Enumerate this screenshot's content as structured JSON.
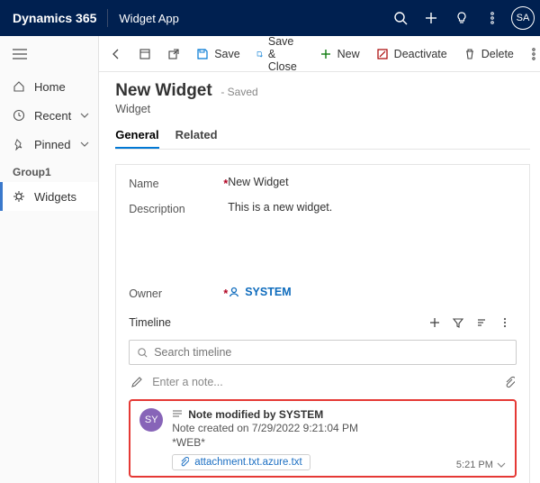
{
  "header": {
    "product": "Dynamics 365",
    "app": "Widget App",
    "avatar": "SA"
  },
  "nav": {
    "home": "Home",
    "recent": "Recent",
    "pinned": "Pinned",
    "group": "Group1",
    "widgets": "Widgets"
  },
  "commands": {
    "save": "Save",
    "saveclose": "Save & Close",
    "new": "New",
    "deactivate": "Deactivate",
    "delete": "Delete"
  },
  "record": {
    "title": "New Widget",
    "savedTag": "- Saved",
    "entity": "Widget",
    "tabs": {
      "general": "General",
      "related": "Related"
    },
    "fields": {
      "nameLabel": "Name",
      "nameValue": "New Widget",
      "descLabel": "Description",
      "descValue": "This is a new widget.",
      "ownerLabel": "Owner",
      "ownerValue": "SYSTEM"
    }
  },
  "timeline": {
    "label": "Timeline",
    "searchPlaceholder": "Search timeline",
    "notePlaceholder": "Enter a note...",
    "note": {
      "avatar": "SY",
      "title": "Note modified by SYSTEM",
      "created": "Note created on 7/29/2022 9:21:04 PM",
      "tag": "*WEB*",
      "attachment": "attachment.txt.azure.txt",
      "time": "5:21 PM"
    }
  }
}
